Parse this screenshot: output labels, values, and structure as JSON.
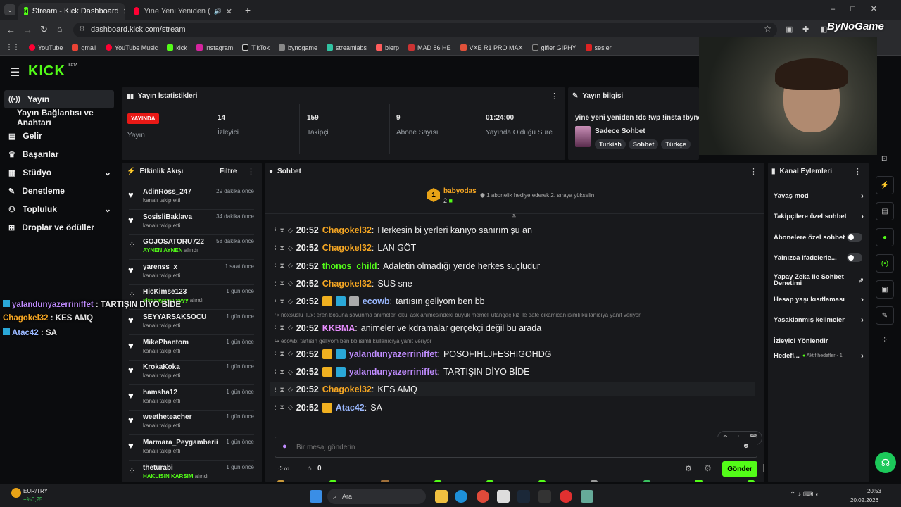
{
  "browser": {
    "tabs": [
      {
        "title": "Stream - Kick Dashboard",
        "active": true
      },
      {
        "title": "Yine Yeni Yeniden (Yeniden",
        "active": false
      }
    ],
    "url": "dashboard.kick.com/stream",
    "bookmarks": [
      "YouTube",
      "gmail",
      "YouTube Music",
      "kick",
      "instagram",
      "TikTok",
      "bynogame",
      "streamlabs",
      "blerp",
      "MAD 86 HE",
      "VXE R1 PRO MAX",
      "gifler GIPHY",
      "sesler"
    ],
    "brand_watermark": "ByNoGame"
  },
  "kick": {
    "logo": "KICK",
    "logo_badge": "BETA",
    "sidebar": [
      {
        "label": "Yayın",
        "icon": "broadcast-icon",
        "active": true
      },
      {
        "label": "Yayın Bağlantısı ve Anahtarı",
        "icon": "",
        "sub": true
      },
      {
        "label": "Gelir",
        "icon": "wallet-icon"
      },
      {
        "label": "Başarılar",
        "icon": "trophy-icon"
      },
      {
        "label": "Stüdyo",
        "icon": "studio-icon",
        "chevron": true
      },
      {
        "label": "Denetleme",
        "icon": "wrench-icon"
      },
      {
        "label": "Topluluk",
        "icon": "people-icon",
        "chevron": true
      },
      {
        "label": "Droplar ve ödüller",
        "icon": "gift-icon"
      }
    ],
    "stats": {
      "title": "Yayın İstatistikleri",
      "live_badge": "YAYINDA",
      "live_label": "Yayın",
      "items": [
        {
          "value": "14",
          "label": "İzleyici"
        },
        {
          "value": "159",
          "label": "Takipçi"
        },
        {
          "value": "9",
          "label": "Abone Sayısı"
        },
        {
          "value": "01:24:00",
          "label": "Yayında Olduğu Süre"
        }
      ]
    },
    "info": {
      "title": "Yayın bilgisi",
      "stream_title": "yine yeni yeniden !dc !wp !insta !bynog",
      "category": "Sadece Sohbet",
      "tags": [
        "Turkish",
        "Sohbet",
        "Türkçe"
      ]
    },
    "activity": {
      "title": "Etkinlik Akışı",
      "filter": "Filtre",
      "items": [
        {
          "name": "AdinRoss_247",
          "sub": "kanalı takip etti",
          "time": "29 dakika önce",
          "icon": "heart-icon",
          "glyph": "♥"
        },
        {
          "name": "SosisliBaklava",
          "sub": "kanalı takip etti",
          "time": "34 dakika önce",
          "icon": "heart-icon",
          "glyph": "♥"
        },
        {
          "name": "GOJOSATORU722",
          "sub": "AYNEN AYNEN",
          "sub2": "alındı",
          "time": "58 dakika önce",
          "icon": "points-icon",
          "glyph": "⁘",
          "green": true
        },
        {
          "name": "yarenss_x",
          "sub": "kanalı takip etti",
          "time": "1 saat önce",
          "icon": "heart-icon",
          "glyph": "♥"
        },
        {
          "name": "HicKimse123",
          "sub": "slsaaayyyyyyyyy",
          "sub2": "alındı",
          "time": "1 gün önce",
          "icon": "points-icon",
          "glyph": "⁘",
          "green": true
        },
        {
          "name": "SEYYARSAKSOCU",
          "sub": "kanalı takip etti",
          "time": "1 gün önce",
          "icon": "heart-icon",
          "glyph": "♥"
        },
        {
          "name": "MikePhantom",
          "sub": "kanalı takip etti",
          "time": "1 gün önce",
          "icon": "heart-icon",
          "glyph": "♥"
        },
        {
          "name": "KrokaKoka",
          "sub": "kanalı takip etti",
          "time": "1 gün önce",
          "icon": "heart-icon",
          "glyph": "♥"
        },
        {
          "name": "hamsha12",
          "sub": "kanalı takip etti",
          "time": "1 gün önce",
          "icon": "heart-icon",
          "glyph": "♥"
        },
        {
          "name": "weetheteacher",
          "sub": "kanalı takip etti",
          "time": "1 gün önce",
          "icon": "heart-icon",
          "glyph": "♥"
        },
        {
          "name": "Marmara_Peygamberii",
          "sub": "kanalı takip etti",
          "time": "1 gün önce",
          "icon": "heart-icon",
          "glyph": "♥"
        },
        {
          "name": "theturabi",
          "sub": "HAKLISIN KARSIM",
          "sub2": "alındı",
          "time": "1 gün önce",
          "icon": "points-icon",
          "glyph": "⁘",
          "green": true
        }
      ]
    },
    "chat": {
      "title": "Sohbet",
      "pinned_user": "babyodas",
      "pinned_rank": "1",
      "pinned_count": "2",
      "pinned_text": "1 abonelik hediye ederek 2. sıraya yükselin",
      "messages": [
        {
          "time": "20:52",
          "user": "Chagokel32",
          "color": "#f5a623",
          "text": "Herkesin bi yerleri kanıyo sanırım şu an"
        },
        {
          "time": "20:52",
          "user": "Chagokel32",
          "color": "#f5a623",
          "text": "LAN GÖT"
        },
        {
          "time": "20:52",
          "user": "thonos_child",
          "color": "#53fc18",
          "text": "Adaletin olmadığı yerde herkes suçludur"
        },
        {
          "time": "20:52",
          "user": "Chagokel32",
          "color": "#f5a623",
          "text": "SUS sne"
        },
        {
          "time": "20:52",
          "user": "ecowb",
          "color": "#9ab8ff",
          "text": "tartısın geliyom ben bb",
          "badges": 3
        },
        {
          "reply": "noxsuslu_lux: eren bosuna savunma animeleri okul ask animesindeki buyuk memeli utangaç kiz ile date cikamican isimli kullanıcıya yanıt veriyor"
        },
        {
          "time": "20:52",
          "user": "KKBMA",
          "color": "#e88dff",
          "text": "animeler ve kdramalar gerçekçi değil bu arada"
        },
        {
          "reply": "ecowb: tartısın geliyom ben bb isimli kullanıcıya yanıt veriyor"
        },
        {
          "time": "20:52",
          "user": "yalandunyazerriniffet",
          "color": "#c08cff",
          "text": "POSOFIHLJFESHIGOHDG",
          "badges": 2
        },
        {
          "time": "20:52",
          "user": "yalandunyazerriniffet",
          "color": "#c08cff",
          "text": "TARTIŞIN DİYO BİDE",
          "badges": 2
        },
        {
          "time": "20:52",
          "user": "Chagokel32",
          "color": "#f5a623",
          "text": "KES AMQ",
          "hover": true
        },
        {
          "time": "20:52",
          "user": "Atac42",
          "color": "#9ab8ff",
          "text": "SA",
          "badges": 1
        }
      ],
      "placeholder": "Bir mesaj gönderin",
      "points": "0",
      "send": "Gönder"
    },
    "actions": {
      "title": "Kanal Eylemleri",
      "items": [
        {
          "label": "Yavaş mod",
          "type": "chevron"
        },
        {
          "label": "Takipçilere özel sohbet",
          "type": "chevron"
        },
        {
          "label": "Abonelere özel sohbet",
          "type": "toggle"
        },
        {
          "label": "Yalnızca ifadelerle...",
          "type": "toggle"
        },
        {
          "label": "Yapay Zeka ile Sohbet Denetimi",
          "type": "external"
        },
        {
          "label": "Hesap yaşı kısıtlaması",
          "type": "chevron"
        },
        {
          "label": "Yasaklanmış kelimeler",
          "type": "chevron"
        },
        {
          "label": "İzleyici Yönlendir",
          "type": "none"
        },
        {
          "label": "Hedefl...",
          "type": "chevron",
          "extra": "Aktif hedefler - 1"
        }
      ]
    },
    "overlay_chat": [
      {
        "user": "yalandunyazerriniffet",
        "color": "#c08cff",
        "text": "TARTIŞIN DİYO BİDE"
      },
      {
        "user": "Chagokel32",
        "color": "#f5a623",
        "text": "KES AMQ"
      },
      {
        "user": "Atac42",
        "color": "#9ab8ff",
        "text": "SA"
      }
    ]
  },
  "taskbar": {
    "ticker_name": "EUR/TRY",
    "ticker_change": "+%0,25",
    "search": "Ara",
    "time": "20:53",
    "date": "20.02.2026"
  }
}
